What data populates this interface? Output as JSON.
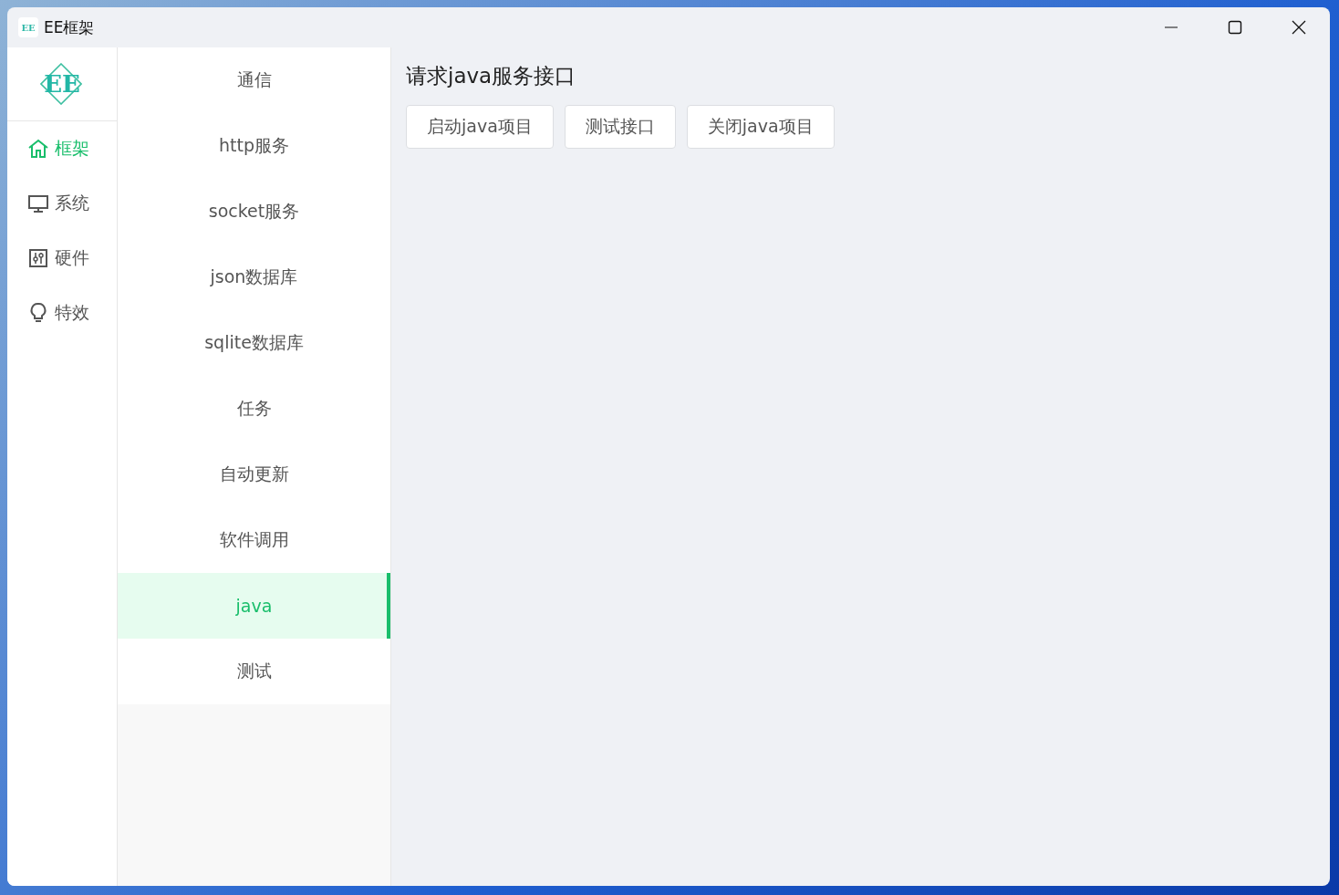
{
  "window": {
    "title": "EE框架",
    "icon_text": "EE"
  },
  "logo": {
    "text": "EE"
  },
  "nav": [
    {
      "label": "框架",
      "kind": "home",
      "selected": true
    },
    {
      "label": "系统",
      "kind": "monitor",
      "selected": false
    },
    {
      "label": "硬件",
      "kind": "sliders",
      "selected": false
    },
    {
      "label": "特效",
      "kind": "bulb",
      "selected": false
    }
  ],
  "submenu": [
    {
      "label": "通信",
      "selected": false
    },
    {
      "label": "http服务",
      "selected": false
    },
    {
      "label": "socket服务",
      "selected": false
    },
    {
      "label": "json数据库",
      "selected": false
    },
    {
      "label": "sqlite数据库",
      "selected": false
    },
    {
      "label": "任务",
      "selected": false
    },
    {
      "label": "自动更新",
      "selected": false
    },
    {
      "label": "软件调用",
      "selected": false
    },
    {
      "label": "java",
      "selected": true
    },
    {
      "label": "测试",
      "selected": false
    }
  ],
  "content": {
    "heading": "请求java服务接口",
    "buttons": [
      "启动java项目",
      "测试接口",
      "关闭java项目"
    ]
  }
}
